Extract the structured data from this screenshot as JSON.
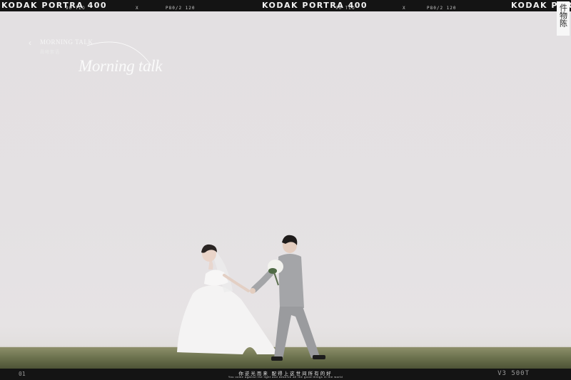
{
  "film_top": {
    "brand": "KODAK PORTRA 400",
    "frame_code_1": "90  TLO",
    "frame_code_2": "X",
    "frame_code_3": "P80/2    120"
  },
  "overlay": {
    "back_icon": "chevron-left-icon",
    "small_title": "MORNING TALK",
    "subtitle": "晨曦絮语",
    "title": "Morning talk"
  },
  "seal": {
    "text": "件物陈"
  },
  "film_bottom": {
    "frame_number": "01",
    "caption_zh": "你逆光而来 配得上这世间所有的好",
    "caption_en": "You come against the light and deserve all the good things in the world",
    "stock": "V3 500T"
  },
  "colors": {
    "sky": "#e3e0e2",
    "grass": "#6e7450",
    "film_border": "#141414",
    "suit": "#a4a5a8",
    "dress": "#f4f3f3"
  }
}
